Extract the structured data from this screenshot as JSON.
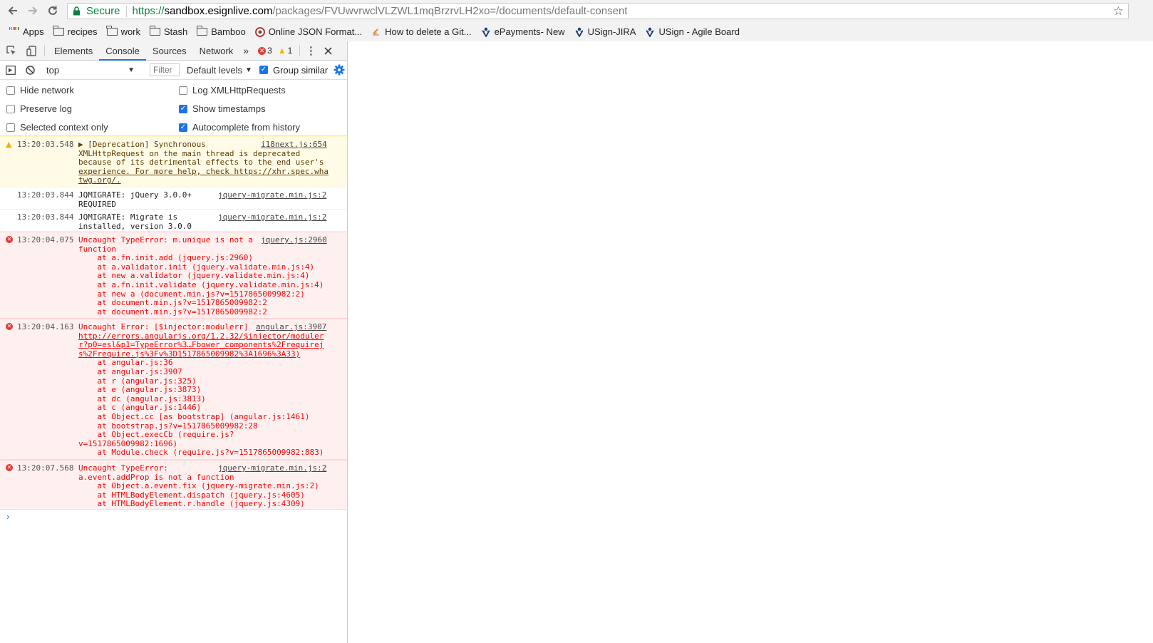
{
  "browser": {
    "secure_label": "Secure",
    "url_scheme": "https://",
    "url_host": "sandbox.esignlive.com",
    "url_path": "/packages/FVUwvrwclVLZWL1mqBrzrvLH2xo=/documents/default-consent",
    "bookmarks": [
      {
        "label": "Apps",
        "icon": "apps-grid-icon"
      },
      {
        "label": "recipes",
        "icon": "folder-icon"
      },
      {
        "label": "work",
        "icon": "folder-icon"
      },
      {
        "label": "Stash",
        "icon": "folder-icon"
      },
      {
        "label": "Bamboo",
        "icon": "folder-icon"
      },
      {
        "label": "Online JSON Format...",
        "icon": "favicon-circle-icon"
      },
      {
        "label": "How to delete a Git...",
        "icon": "favicon-stack-icon"
      },
      {
        "label": "ePayments- New",
        "icon": "jira-icon"
      },
      {
        "label": "USign-JIRA",
        "icon": "jira-icon"
      },
      {
        "label": "USign - Agile Board",
        "icon": "jira-icon"
      }
    ]
  },
  "devtools": {
    "tabs": [
      "Elements",
      "Console",
      "Sources",
      "Network"
    ],
    "active_tab": "Console",
    "error_count": "3",
    "warning_count": "1",
    "context": "top",
    "filter_placeholder": "Filter",
    "levels_label": "Default levels",
    "group_similar_label": "Group similar",
    "settings": {
      "hide_network": {
        "label": "Hide network",
        "checked": false
      },
      "preserve_log": {
        "label": "Preserve log",
        "checked": false
      },
      "selected_context_only": {
        "label": "Selected context only",
        "checked": false
      },
      "log_xhr": {
        "label": "Log XMLHttpRequests",
        "checked": false
      },
      "show_timestamps": {
        "label": "Show timestamps",
        "checked": true
      },
      "autocomplete_history": {
        "label": "Autocomplete from history",
        "checked": true
      }
    },
    "messages": {
      "m1": {
        "time": "13:20:03.548",
        "lines": [
          "▶ [Deprecation] Synchronous",
          "XMLHttpRequest on the main thread is deprecated",
          "because of its detrimental effects to the end user's",
          "experience. For more help, check https://xhr.spec.wha",
          "twg.org/."
        ],
        "source": "i18next.js:654"
      },
      "m2": {
        "time": "13:20:03.844",
        "lines": [
          "JQMIGRATE: jQuery 3.0.0+",
          "REQUIRED"
        ],
        "source": "jquery-migrate.min.js:2"
      },
      "m3": {
        "time": "13:20:03.844",
        "lines": [
          "JQMIGRATE: Migrate is",
          "installed, version 3.0.0"
        ],
        "source": "jquery-migrate.min.js:2"
      },
      "m4": {
        "time": "13:20:04.075",
        "lines": [
          "Uncaught TypeError: m.unique is not a",
          "function",
          "    at a.fn.init.add (jquery.js:2960)",
          "    at a.validator.init (jquery.validate.min.js:4)",
          "    at new a.validator (jquery.validate.min.js:4)",
          "    at a.fn.init.validate (jquery.validate.min.js:4)",
          "    at new a (document.min.js?v=1517865009982:2)",
          "    at document.min.js?v=1517865009982:2",
          "    at document.min.js?v=1517865009982:2"
        ],
        "source": "jquery.js:2960"
      },
      "m5": {
        "time": "13:20:04.163",
        "lines": [
          "Uncaught Error: [$injector:modulerr]",
          "http://errors.angularjs.org/1.2.32/$injector/moduler",
          "r?p0=esl&p1=TypeError%3…Fbower_components%2Frequirej",
          "s%2Frequire.js%3Fv%3D1517865009982%3A1696%3A33)",
          "    at angular.js:36",
          "    at angular.js:3907",
          "    at r (angular.js:325)",
          "    at e (angular.js:3873)",
          "    at dc (angular.js:3813)",
          "    at c (angular.js:1446)",
          "    at Object.cc [as bootstrap] (angular.js:1461)",
          "    at bootstrap.js?v=1517865009982:28",
          "    at Object.execCb (require.js?",
          "v=1517865009982:1696)",
          "    at Module.check (require.js?v=1517865009982:883)"
        ],
        "source": "angular.js:3907"
      },
      "m6": {
        "time": "13:20:07.568",
        "lines": [
          "Uncaught TypeError:",
          "a.event.addProp is not a function",
          "    at Object.a.event.fix (jquery-migrate.min.js:2)",
          "    at HTMLBodyElement.dispatch (jquery.js:4605)",
          "    at HTMLBodyElement.r.handle (jquery.js:4309)"
        ],
        "source": "jquery-migrate.min.js:2"
      }
    },
    "prompt_symbol": "›"
  }
}
